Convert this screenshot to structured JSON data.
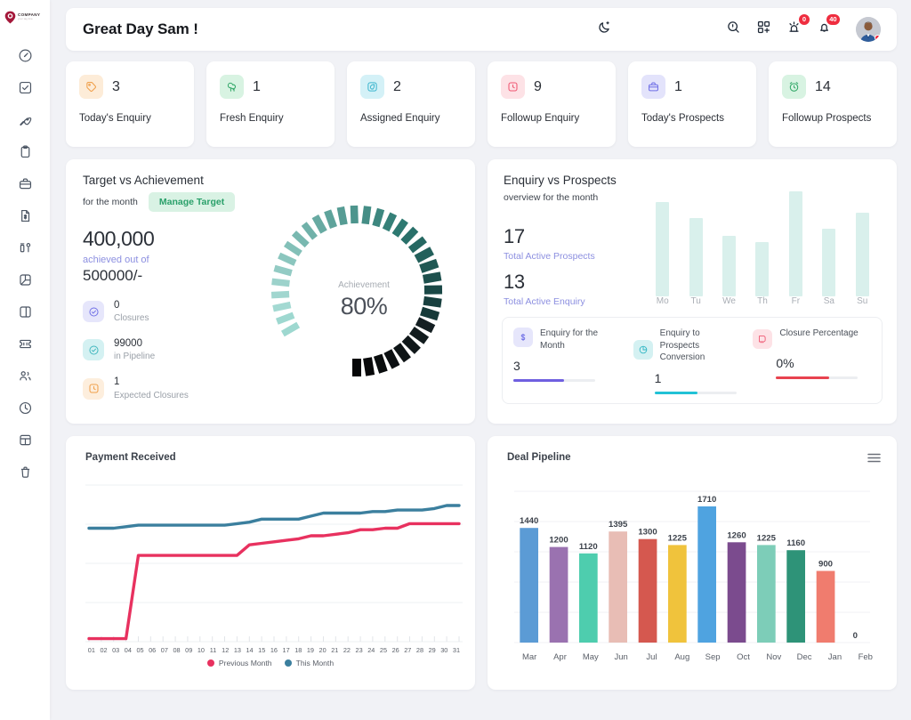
{
  "brand": {
    "name": "COMPANY",
    "tagline": "your tag line",
    "color": "#a4183a"
  },
  "sidebar": {
    "items": [
      {
        "name": "dashboard",
        "icon": "gauge-icon"
      },
      {
        "name": "tasks",
        "icon": "check-square-icon"
      },
      {
        "name": "leads",
        "icon": "rocket-icon"
      },
      {
        "name": "clipboard",
        "icon": "clipboard-icon"
      },
      {
        "name": "deals",
        "icon": "briefcase-icon"
      },
      {
        "name": "invoices",
        "icon": "file-dollar-icon"
      },
      {
        "name": "reports",
        "icon": "stats-icon"
      },
      {
        "name": "campaigns",
        "icon": "pie-chart-icon"
      },
      {
        "name": "layout",
        "icon": "panel-icon"
      },
      {
        "name": "tickets",
        "icon": "ticket-icon"
      },
      {
        "name": "contacts",
        "icon": "users-icon"
      },
      {
        "name": "activity",
        "icon": "clock-icon"
      },
      {
        "name": "grid",
        "icon": "table-icon"
      },
      {
        "name": "trash",
        "icon": "trash-icon"
      }
    ]
  },
  "header": {
    "greeting": "Great Day Sam !",
    "theme_toggle": "moon-icon",
    "search": "search-icon",
    "scan": "qr-scan-icon",
    "alerts": {
      "icon": "siren-icon",
      "count": "0"
    },
    "notifications": {
      "icon": "bell-icon",
      "count": "40"
    },
    "avatar": "user-avatar"
  },
  "stats": [
    {
      "value": "3",
      "label": "Today's Enquiry",
      "icon": "tag-icon",
      "icon_bg": "#fdecd8",
      "icon_color": "#f0a04b"
    },
    {
      "value": "1",
      "label": "Fresh Enquiry",
      "icon": "tree-icon",
      "icon_bg": "#d8f3e2",
      "icon_color": "#35a96a"
    },
    {
      "value": "2",
      "label": "Assigned Enquiry",
      "icon": "leaf-icon",
      "icon_bg": "#d4f1f7",
      "icon_color": "#3fb6ce"
    },
    {
      "value": "9",
      "label": "Followup Enquiry",
      "icon": "clock-alt-icon",
      "icon_bg": "#fde2e6",
      "icon_color": "#ef5772"
    },
    {
      "value": "1",
      "label": "Today's Prospects",
      "icon": "briefcase-icon",
      "icon_bg": "#e3e3fb",
      "icon_color": "#6f6fe6"
    },
    {
      "value": "14",
      "label": "Followup Prospects",
      "icon": "alarm-icon",
      "icon_bg": "#d8f3e2",
      "icon_color": "#35a96a"
    }
  ],
  "target": {
    "title": "Target vs Achievement",
    "subtitle": "for the month",
    "manage_button": "Manage Target",
    "achieved": "400,000",
    "achieved_of": "achieved out of",
    "goal": "500000/-",
    "gauge_label": "Achievement",
    "gauge_percent": "80%",
    "gauge_value": 80,
    "breakdown": [
      {
        "value": "0",
        "caption": "Closures",
        "icon": "check-circle-icon",
        "icon_bg": "#e6e6fb",
        "icon_color": "#6f6fe6"
      },
      {
        "value": "99000",
        "caption": "in Pipeline",
        "icon": "check-circle-icon",
        "icon_bg": "#d4f1f2",
        "icon_color": "#3fb6bd"
      },
      {
        "value": "1",
        "caption": "Expected Closures",
        "icon": "clock-alt-icon",
        "icon_bg": "#fdeedd",
        "icon_color": "#f0a04b"
      }
    ]
  },
  "prospects": {
    "title": "Enquiry vs Prospects",
    "subtitle": "overview for the month",
    "active_prospects": {
      "value": "17",
      "caption": "Total Active Prospects"
    },
    "active_enquiry": {
      "value": "13",
      "caption": "Total Active Enquiry"
    },
    "metrics": [
      {
        "title": "Enquiry for the Month",
        "value": "3",
        "icon": "dollar-icon",
        "icon_bg": "#e6e6fb",
        "icon_color": "#6f6fe6",
        "bar_color": "#6f5fe0",
        "bar_pct": 62
      },
      {
        "title": "Enquiry to Prospects Conversion",
        "value": "1",
        "icon": "pie-clock-icon",
        "icon_bg": "#d4f1f2",
        "icon_color": "#31b6c4",
        "bar_color": "#22c2d6",
        "bar_pct": 52
      },
      {
        "title": "Closure Percentage",
        "value": "0%",
        "icon": "closure-icon",
        "icon_bg": "#fde2e6",
        "icon_color": "#ef5772",
        "bar_color": "#e8434f",
        "bar_pct": 65
      }
    ]
  },
  "chart_data": [
    {
      "type": "bar",
      "id": "weekly-overview",
      "title": "Enquiry vs Prospects",
      "subtitle": "overview for the month",
      "categories": [
        "Mo",
        "Tu",
        "We",
        "Th",
        "Fr",
        "Sa",
        "Su"
      ],
      "values": [
        90,
        75,
        58,
        52,
        100,
        64,
        80
      ],
      "ylim": [
        0,
        100
      ],
      "grid": false,
      "legend": "none",
      "bar_color": "#d9f0ec",
      "xlabel": "",
      "ylabel": ""
    },
    {
      "type": "line",
      "id": "payment-received",
      "title": "Payment Received",
      "xlabel": "",
      "ylabel": "",
      "grid": true,
      "legend": "bottom",
      "x": [
        "01",
        "02",
        "03",
        "04",
        "05",
        "06",
        "07",
        "08",
        "09",
        "10",
        "11",
        "12",
        "13",
        "14",
        "15",
        "16",
        "17",
        "18",
        "19",
        "20",
        "21",
        "22",
        "23",
        "24",
        "25",
        "26",
        "27",
        "28",
        "29",
        "30",
        "31"
      ],
      "series": [
        {
          "name": "Previous Month",
          "color": "#e8315f",
          "values": [
            2,
            2,
            2,
            2,
            57,
            57,
            57,
            57,
            57,
            57,
            57,
            57,
            57,
            64,
            65,
            66,
            67,
            68,
            70,
            70,
            71,
            72,
            74,
            74,
            75,
            75,
            78,
            78,
            78,
            78,
            78
          ]
        },
        {
          "name": "This Month",
          "color": "#3b7f9e",
          "values": [
            75,
            75,
            75,
            76,
            77,
            77,
            77,
            77,
            77,
            77,
            77,
            77,
            78,
            79,
            81,
            81,
            81,
            81,
            83,
            85,
            85,
            85,
            85,
            86,
            86,
            87,
            87,
            87,
            88,
            90,
            90
          ]
        }
      ],
      "ylim": [
        0,
        100
      ]
    },
    {
      "type": "bar",
      "id": "deal-pipeline",
      "title": "Deal Pipeline",
      "xlabel": "",
      "ylabel": "",
      "grid": true,
      "legend": "none",
      "categories": [
        "Mar",
        "Apr",
        "May",
        "Jun",
        "Jul",
        "Aug",
        "Sep",
        "Oct",
        "Nov",
        "Dec",
        "Jan",
        "Feb"
      ],
      "values": [
        1440,
        1200,
        1120,
        1395,
        1300,
        1225,
        1710,
        1260,
        1225,
        1160,
        900,
        0
      ],
      "labels": [
        "1440",
        "1200",
        "1120",
        "1395",
        "1300",
        "1225",
        "1710",
        "1260",
        "1225",
        "1160",
        "900",
        "0"
      ],
      "colors": [
        "#5b9bd5",
        "#9a72b0",
        "#4ecdae",
        "#e8bdb5",
        "#d5584f",
        "#f0c33c",
        "#4fa3e0",
        "#7b4b8e",
        "#7dcdb8",
        "#2e9378",
        "#f07c6e",
        "#ffffff"
      ],
      "ylim": [
        0,
        1900
      ]
    }
  ],
  "payment_chart": {
    "title": "Payment Received"
  },
  "deal_chart": {
    "title": "Deal Pipeline",
    "menu": "hamburger-menu-icon"
  }
}
